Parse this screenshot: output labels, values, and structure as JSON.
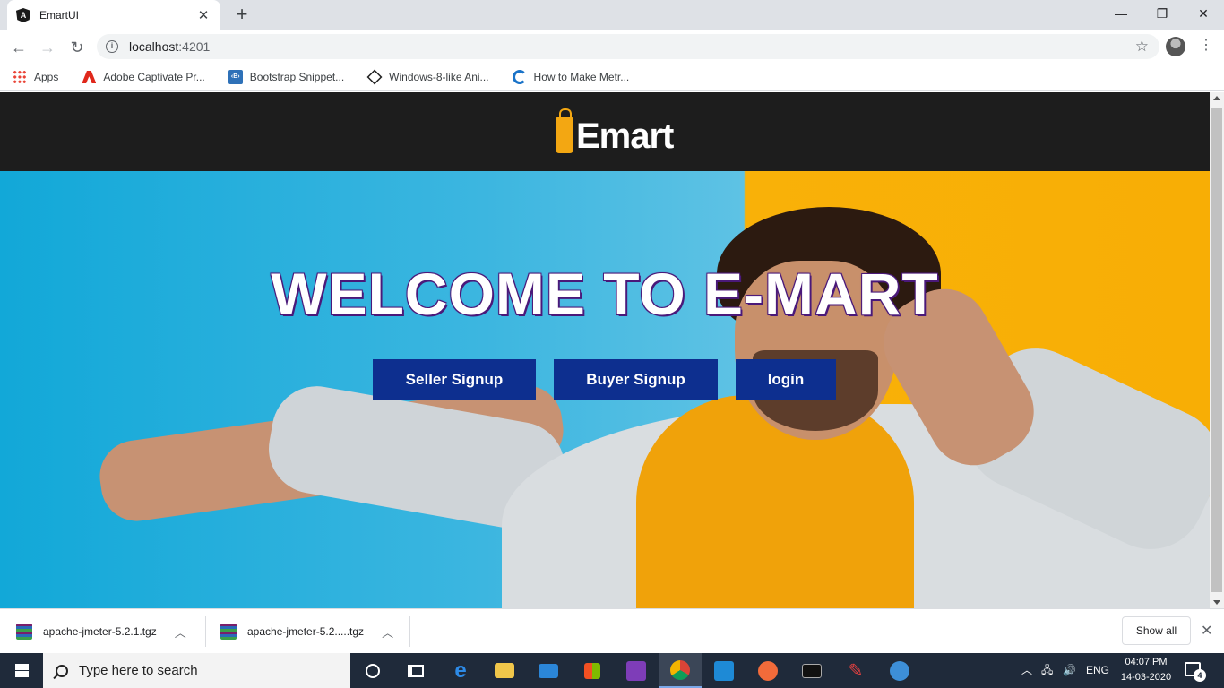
{
  "browser": {
    "tab_title": "EmartUI",
    "tab_favicon_letter": "A",
    "url_host": "localhost",
    "url_port": ":4201",
    "bookmarks": [
      {
        "label": "Apps",
        "icon": "apps-grid-icon"
      },
      {
        "label": "Adobe Captivate Pr...",
        "icon": "adobe-icon"
      },
      {
        "label": "Bootstrap Snippet...",
        "icon": "bootstrap-icon"
      },
      {
        "label": "Windows-8-like Ani...",
        "icon": "codepen-icon"
      },
      {
        "label": "How to Make Metr...",
        "icon": "metro-icon"
      }
    ]
  },
  "page": {
    "logo_text": "Emart",
    "heading": "WELCOME TO E-MART",
    "buttons": {
      "seller": "Seller Signup",
      "buyer": "Buyer Signup",
      "login": "login"
    },
    "colors": {
      "navbar": "#1d1d1d",
      "button": "#0d2f8f",
      "accent": "#f3a712"
    }
  },
  "downloads": {
    "items": [
      {
        "name": "apache-jmeter-5.2.1.tgz"
      },
      {
        "name": "apache-jmeter-5.2.....tgz"
      }
    ],
    "show_all": "Show all"
  },
  "taskbar": {
    "search_placeholder": "Type here to search",
    "language": "ENG",
    "time": "04:07 PM",
    "date": "14-03-2020",
    "notification_count": "4"
  }
}
